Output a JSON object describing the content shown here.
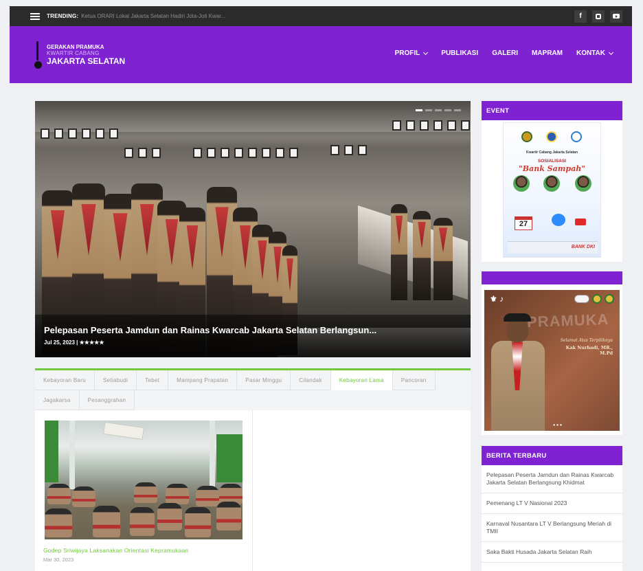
{
  "topbar": {
    "trending_label": "TRENDING:",
    "trending_text": "Ketua ORARI Lokal Jakarta Selatan Hadiri Jota-Joti Kwar...",
    "social": [
      {
        "name": "facebook-icon",
        "glyph": "f"
      },
      {
        "name": "instagram-icon",
        "glyph": ""
      },
      {
        "name": "youtube-icon",
        "glyph": ""
      }
    ]
  },
  "header": {
    "logo": {
      "line1": "GERAKAN PRAMUKA",
      "line2": "KWARTIR CABANG",
      "line3": "JAKARTA SELATAN"
    },
    "nav": [
      {
        "label": "PROFIL",
        "dropdown": true
      },
      {
        "label": "PUBLIKASI",
        "dropdown": false
      },
      {
        "label": "GALERI",
        "dropdown": false
      },
      {
        "label": "MAPRAM",
        "dropdown": false
      },
      {
        "label": "KONTAK",
        "dropdown": true
      }
    ],
    "accent_color": "#7f22d1"
  },
  "hero": {
    "title": "Pelepasan Peserta Jamdun dan Rainas Kwarcab Jakarta Selatan Berlangsun...",
    "date": "Jul 25, 2023 |",
    "rating": "★★★★★",
    "slides": 5,
    "active_slide": 1
  },
  "tabs": {
    "accent_color": "#71c73d",
    "items": [
      {
        "label": "Kebayoran Baru",
        "active": false
      },
      {
        "label": "Setiabudi",
        "active": false
      },
      {
        "label": "Tebet",
        "active": false
      },
      {
        "label": "Mampang Prapatan",
        "active": false
      },
      {
        "label": "Pasar Minggu",
        "active": false
      },
      {
        "label": "Cilandak",
        "active": false
      },
      {
        "label": "Kebayoran Lama",
        "active": true
      },
      {
        "label": "Pancoran",
        "active": false
      },
      {
        "label": "Jagakarsa",
        "active": false
      },
      {
        "label": "Pesanggrahan",
        "active": false
      }
    ],
    "post": {
      "title": "Godep Sriwijaya Laksanakan Orientasi Kepramukaan",
      "date": "Mar 30, 2023"
    }
  },
  "sidebar": {
    "event": {
      "heading": "EVENT",
      "poster": {
        "org": "Kwartir Cabang Jakarta Selatan",
        "kicker": "SOSIALISASI",
        "headline": "\"Bank Sampah\"",
        "day": "27",
        "sponsor": "BANK DKI"
      }
    },
    "photo": {
      "heading": "",
      "watermark": "PRAMUKA",
      "greeting": "Selamat Atas Terpilihnya",
      "person": "Kak Nurhadi, MR., M.Pd"
    },
    "berita": {
      "heading": "BERITA TERBARU",
      "items": [
        "Pelepasan Peserta Jamdun dan Rainas Kwarcab Jakarta Selatan Berlangsung Khidmat",
        "Pemenang LT V Nasional 2023",
        "Karnaval Nusantara LT V Berlangsung Meriah di TMII",
        "Saka Bakti Husada Jakarta Selatan Raih"
      ]
    }
  }
}
